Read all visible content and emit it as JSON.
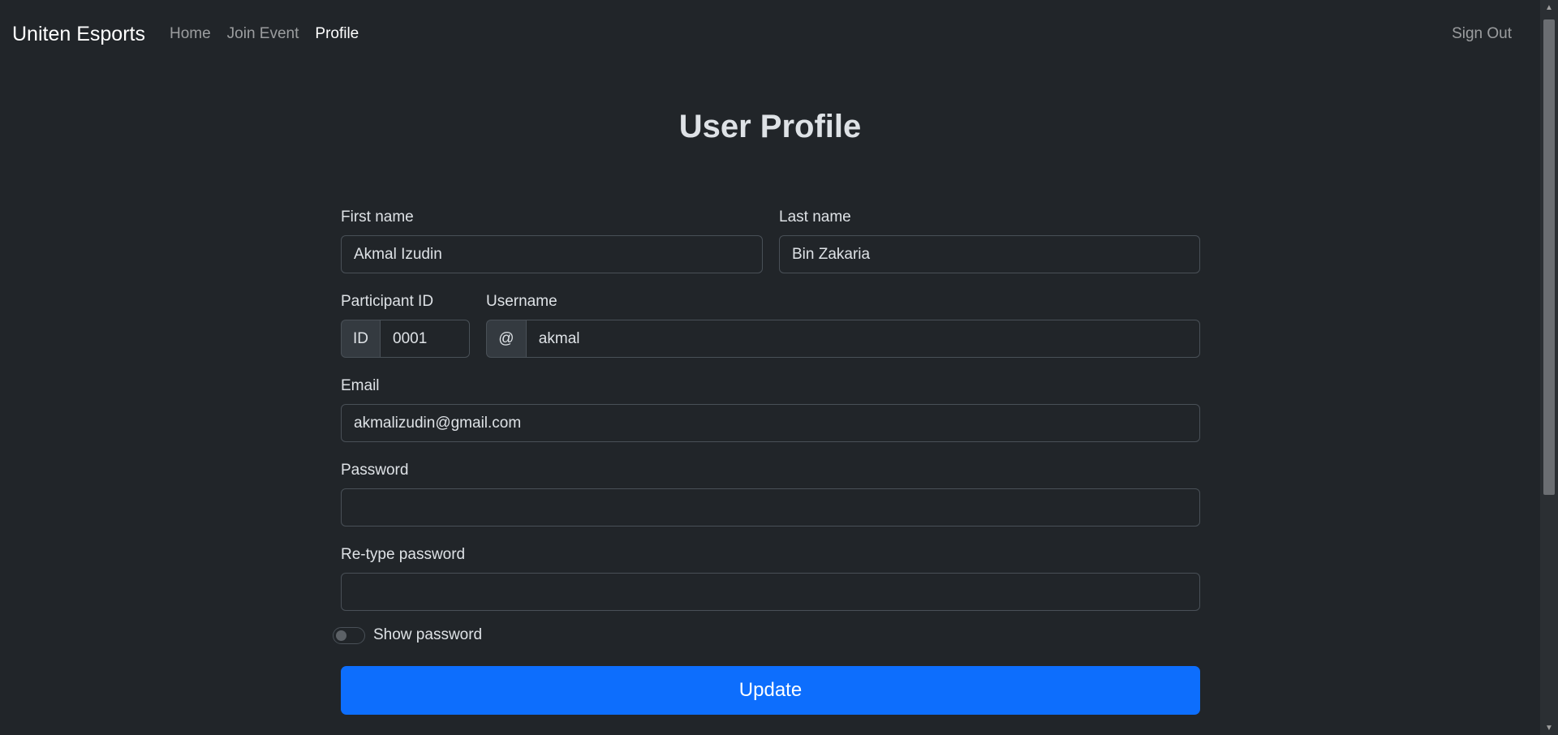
{
  "navbar": {
    "brand": "Uniten Esports",
    "links": [
      {
        "label": "Home"
      },
      {
        "label": "Join Event"
      },
      {
        "label": "Profile"
      }
    ],
    "sign_out": "Sign Out"
  },
  "page": {
    "title": "User Profile"
  },
  "form": {
    "first_name": {
      "label": "First name",
      "value": "Akmal Izudin"
    },
    "last_name": {
      "label": "Last name",
      "value": "Bin Zakaria"
    },
    "participant_id": {
      "label": "Participant ID",
      "prefix": "ID",
      "value": "0001"
    },
    "username": {
      "label": "Username",
      "prefix": "@",
      "value": "akmal"
    },
    "email": {
      "label": "Email",
      "value": "akmalizudin@gmail.com"
    },
    "password": {
      "label": "Password",
      "value": ""
    },
    "retype_password": {
      "label": "Re-type password",
      "value": ""
    },
    "show_password": {
      "label": "Show password",
      "checked": false
    },
    "submit_label": "Update"
  },
  "colors": {
    "background": "#212529",
    "primary": "#0d6efd",
    "text": "#dee2e6"
  }
}
